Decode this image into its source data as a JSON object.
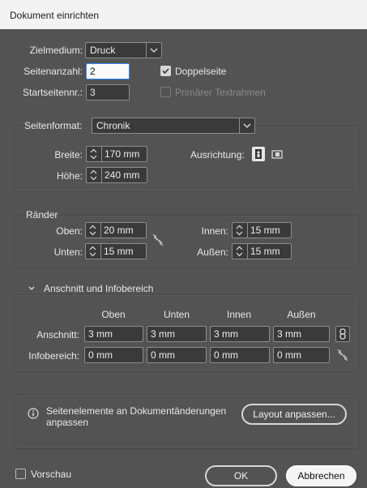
{
  "window": {
    "title": "Dokument einrichten"
  },
  "main": {
    "zielmedium": {
      "label": "Zielmedium:",
      "value": "Druck"
    },
    "seitenanzahl": {
      "label": "Seitenanzahl:",
      "value": "2"
    },
    "startseite": {
      "label": "Startseitennr.:",
      "value": "3"
    },
    "doppelseite": {
      "label": "Doppelseite",
      "checked": true
    },
    "primaer": {
      "label": "Primärer Textrahmen",
      "checked": false,
      "enabled": false
    }
  },
  "format": {
    "label": "Seitenformat:",
    "value": "Chronik",
    "breite_label": "Breite:",
    "breite_value": "170 mm",
    "hoehe_label": "Höhe:",
    "hoehe_value": "240 mm",
    "ausrichtung_label": "Ausrichtung:"
  },
  "raender": {
    "title": "Ränder",
    "oben_label": "Oben:",
    "oben_value": "20 mm",
    "unten_label": "Unten:",
    "unten_value": "15 mm",
    "innen_label": "Innen:",
    "innen_value": "15 mm",
    "aussen_label": "Außen:",
    "aussen_value": "15 mm"
  },
  "anschnitt": {
    "title": "Anschnitt und Infobereich",
    "columns": [
      "Oben",
      "Unten",
      "Innen",
      "Außen"
    ],
    "anschnitt_label": "Anschnitt:",
    "anschnitt_values": [
      "3 mm",
      "3 mm",
      "3 mm",
      "3 mm"
    ],
    "info_label": "Infobereich:",
    "info_values": [
      "0 mm",
      "0 mm",
      "0 mm",
      "0 mm"
    ]
  },
  "layout": {
    "text": "Seitenelemente an Dokumentänderungen anpassen",
    "text_line1": "Seitenelemente an Dokumentänderungen",
    "text_line2": "anpassen",
    "button": "Layout anpassen..."
  },
  "footer": {
    "vorschau": "Vorschau",
    "ok": "OK",
    "abbrechen": "Abbrechen"
  }
}
